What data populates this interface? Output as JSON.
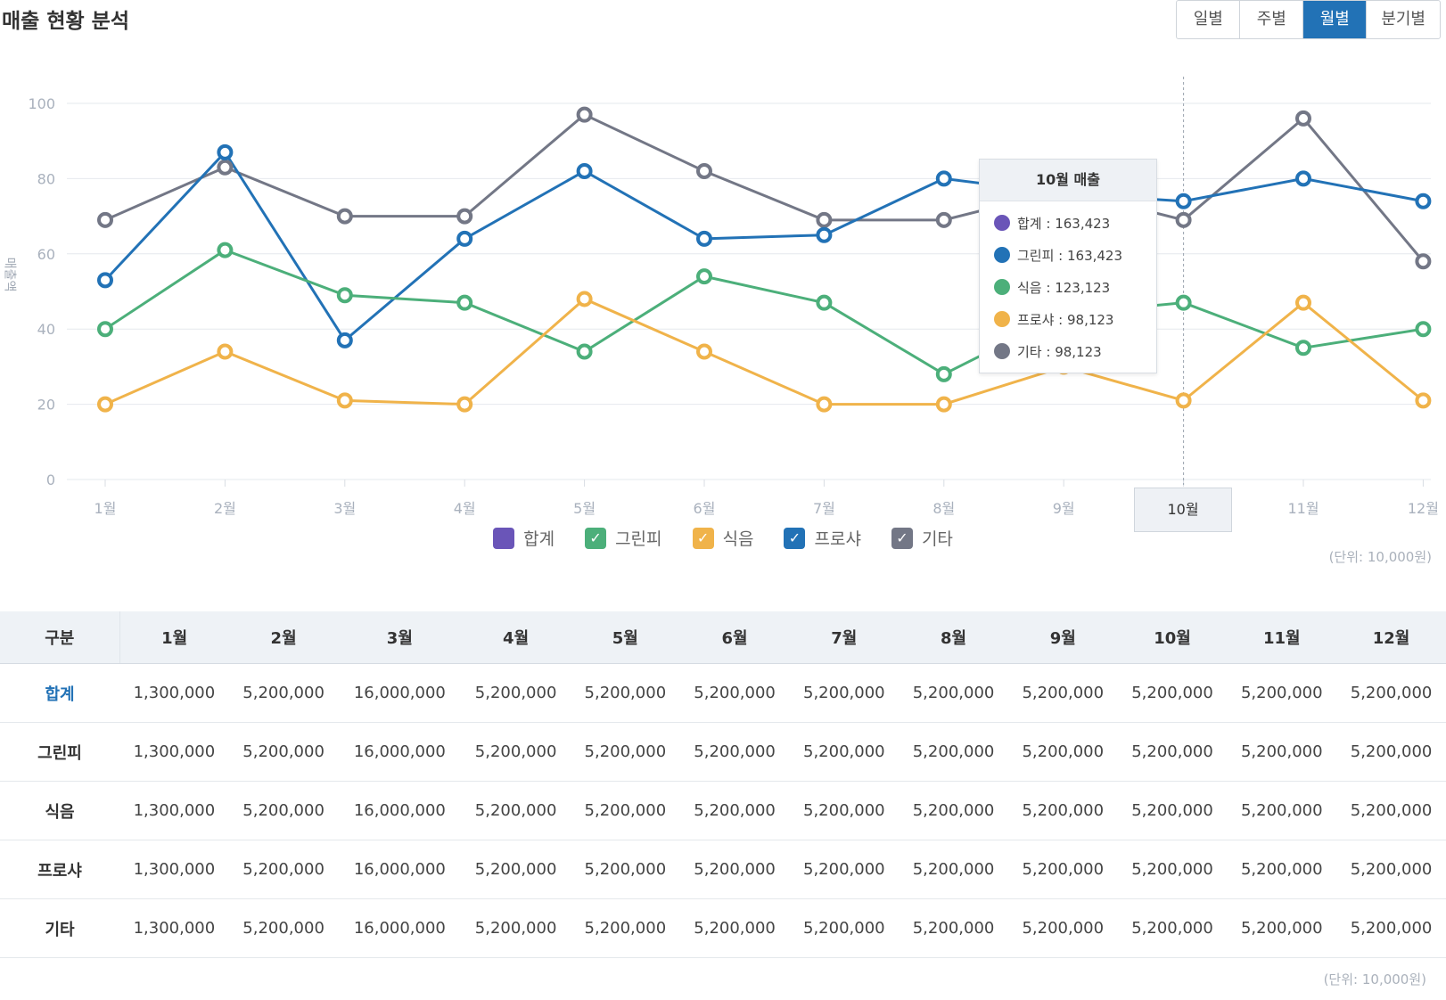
{
  "page": {
    "title": "매출 현황 분석"
  },
  "period_tabs": [
    {
      "label": "일별",
      "active": false
    },
    {
      "label": "주별",
      "active": false
    },
    {
      "label": "월별",
      "active": true
    },
    {
      "label": "분기별",
      "active": false
    }
  ],
  "colors": {
    "sum": "#6a55b8",
    "greenpi": "#4caf7a",
    "food": "#f0b34a",
    "prosha": "#2272b6",
    "etc": "#737786",
    "accent": "#2272b6"
  },
  "chart_data": {
    "type": "line",
    "ylabel": "매출액",
    "ylim": [
      0,
      100
    ],
    "yticks": [
      0,
      20,
      40,
      60,
      80,
      100
    ],
    "grid": true,
    "categories": [
      "1월",
      "2월",
      "3월",
      "4월",
      "5월",
      "6월",
      "7월",
      "8월",
      "9월",
      "10월",
      "11월",
      "12월"
    ],
    "series": [
      {
        "name": "기타",
        "color": "#737786",
        "values": [
          69,
          83,
          70,
          70,
          97,
          82,
          69,
          69,
          77,
          69,
          96,
          58
        ]
      },
      {
        "name": "프로샤",
        "color": "#2272b6",
        "values": [
          53,
          87,
          37,
          64,
          82,
          64,
          65,
          80,
          76,
          74,
          80,
          74
        ]
      },
      {
        "name": "그린피",
        "color": "#4caf7a",
        "values": [
          40,
          61,
          49,
          47,
          34,
          54,
          47,
          28,
          44,
          47,
          35,
          40
        ]
      },
      {
        "name": "식음",
        "color": "#f0b34a",
        "values": [
          20,
          34,
          21,
          20,
          48,
          34,
          20,
          20,
          30,
          21,
          47,
          21
        ]
      }
    ],
    "highlight_category": "10월",
    "unit": "(단위: 10,000원)"
  },
  "legend": [
    {
      "label": "합계",
      "color": "#6a55b8",
      "checked": false
    },
    {
      "label": "그린피",
      "color": "#4caf7a",
      "checked": true
    },
    {
      "label": "식음",
      "color": "#f0b34a",
      "checked": true
    },
    {
      "label": "프로샤",
      "color": "#2272b6",
      "checked": true
    },
    {
      "label": "기타",
      "color": "#737786",
      "checked": true
    }
  ],
  "tooltip": {
    "title": "10월 매출",
    "rows": [
      {
        "text": "합계 : 163,423",
        "color": "#6a55b8"
      },
      {
        "text": "그린피 : 163,423",
        "color": "#2272b6"
      },
      {
        "text": "식음 : 123,123",
        "color": "#4caf7a"
      },
      {
        "text": "프로샤 : 98,123",
        "color": "#f0b34a"
      },
      {
        "text": "기타 : 98,123",
        "color": "#737786"
      }
    ]
  },
  "table": {
    "header": [
      "구분",
      "1월",
      "2월",
      "3월",
      "4월",
      "5월",
      "6월",
      "7월",
      "8월",
      "9월",
      "10월",
      "11월",
      "12월"
    ],
    "rows": [
      {
        "label": "합계",
        "cells": [
          "1,300,000",
          "5,200,000",
          "16,000,000",
          "5,200,000",
          "5,200,000",
          "5,200,000",
          "5,200,000",
          "5,200,000",
          "5,200,000",
          "5,200,000",
          "5,200,000",
          "5,200,000"
        ]
      },
      {
        "label": "그린피",
        "cells": [
          "1,300,000",
          "5,200,000",
          "16,000,000",
          "5,200,000",
          "5,200,000",
          "5,200,000",
          "5,200,000",
          "5,200,000",
          "5,200,000",
          "5,200,000",
          "5,200,000",
          "5,200,000"
        ]
      },
      {
        "label": "식음",
        "cells": [
          "1,300,000",
          "5,200,000",
          "16,000,000",
          "5,200,000",
          "5,200,000",
          "5,200,000",
          "5,200,000",
          "5,200,000",
          "5,200,000",
          "5,200,000",
          "5,200,000",
          "5,200,000"
        ]
      },
      {
        "label": "프로샤",
        "cells": [
          "1,300,000",
          "5,200,000",
          "16,000,000",
          "5,200,000",
          "5,200,000",
          "5,200,000",
          "5,200,000",
          "5,200,000",
          "5,200,000",
          "5,200,000",
          "5,200,000",
          "5,200,000"
        ]
      },
      {
        "label": "기타",
        "cells": [
          "1,300,000",
          "5,200,000",
          "16,000,000",
          "5,200,000",
          "5,200,000",
          "5,200,000",
          "5,200,000",
          "5,200,000",
          "5,200,000",
          "5,200,000",
          "5,200,000",
          "5,200,000"
        ]
      }
    ],
    "unit": "(단위: 10,000원)"
  }
}
